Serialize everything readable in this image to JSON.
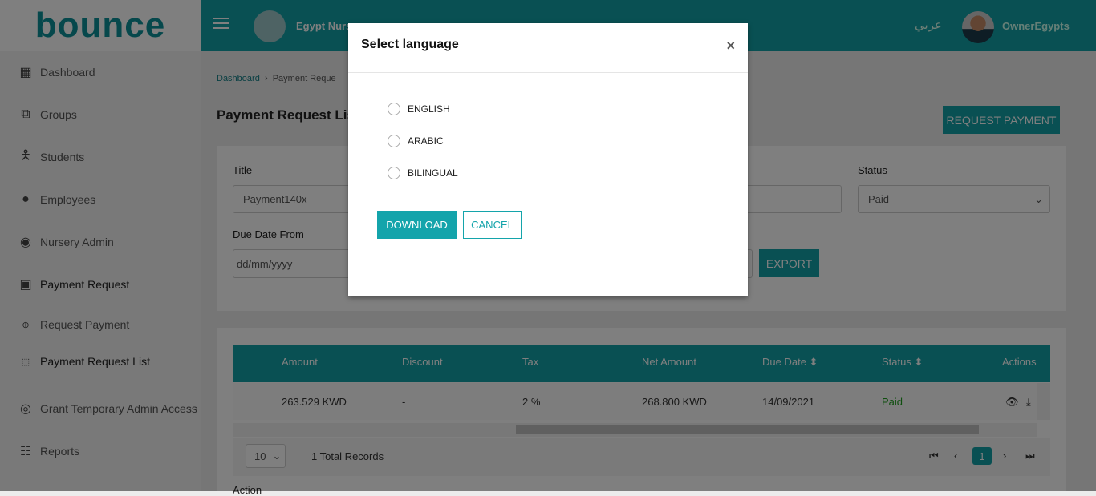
{
  "brand": {
    "logo": "bounce"
  },
  "sidebar": {
    "items": [
      {
        "label": "Dashboard",
        "icon": "dashboard-icon"
      },
      {
        "label": "Groups",
        "icon": "groups-icon"
      },
      {
        "label": "Students",
        "icon": "student-icon"
      },
      {
        "label": "Employees",
        "icon": "employees-icon"
      },
      {
        "label": "Nursery Admin",
        "icon": "user-icon"
      },
      {
        "label": "Payment Request",
        "icon": "money-icon"
      },
      {
        "label": "Request Payment",
        "icon": "plus-circle-icon"
      },
      {
        "label": "Payment Request List",
        "icon": "list-icon"
      },
      {
        "label": "Grant Temporary Admin Access",
        "icon": "lifebuoy-icon"
      },
      {
        "label": "Reports",
        "icon": "clipboard-icon"
      }
    ]
  },
  "header": {
    "school_name": "Egypt Nurs",
    "language_toggle": "عربي",
    "user_name": "OwnerEgypts"
  },
  "breadcrumb": [
    "Dashboard",
    "Payment Reque"
  ],
  "page": {
    "title": "Payment Request Lis",
    "request_payment_label": "REQUEST PAYMENT"
  },
  "filters": {
    "title_label": "Title",
    "title_value": "Payment140x",
    "status_label": "Status",
    "status_value": "Paid",
    "due_from_label": "Due Date From",
    "due_from_placeholder": "dd/mm/yyyy",
    "export_label": "EXPORT"
  },
  "table": {
    "columns": [
      "Amount",
      "Discount",
      "Tax",
      "Net Amount",
      "Due Date",
      "Status",
      "Actions"
    ],
    "rows": [
      {
        "amount": "263.529 KWD",
        "discount": "-",
        "tax": "2 %",
        "net": "268.800 KWD",
        "due": "14/09/2021",
        "status": "Paid"
      }
    ],
    "page_size": "10",
    "total": "1 Total Records",
    "current_page": "1"
  },
  "bottom": {
    "action_label": "Action"
  },
  "modal": {
    "title": "Select language",
    "close": "×",
    "options": [
      "ENGLISH",
      "ARABIC",
      "BILINGUAL"
    ],
    "download": "DOWNLOAD",
    "cancel": "CANCEL"
  },
  "colors": {
    "teal": "#12a0a6",
    "paid": "#1e9e1e"
  }
}
